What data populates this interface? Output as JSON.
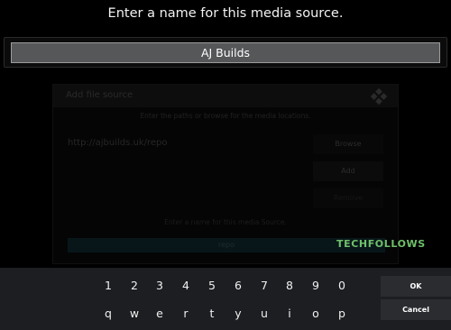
{
  "prompt": {
    "title": "Enter a name for this media source."
  },
  "name_input": {
    "value": "AJ Builds"
  },
  "background_dialog": {
    "title": "Add file source",
    "instructions": "Enter the paths or browse for the media locations.",
    "path": "http://ajbuilds.uk/repo",
    "browse_label": "Browse",
    "add_label": "Add",
    "remove_label": "Remove",
    "name_prompt": "Enter a name for this media Source.",
    "name_value": "repo"
  },
  "watermark": {
    "text": "TECHFOLLOWS"
  },
  "keyboard": {
    "row1": [
      "1",
      "2",
      "3",
      "4",
      "5",
      "6",
      "7",
      "8",
      "9",
      "0"
    ],
    "row2": [
      "q",
      "w",
      "e",
      "r",
      "t",
      "y",
      "u",
      "i",
      "o",
      "p"
    ],
    "ok_label": "OK",
    "cancel_label": "Cancel"
  },
  "colors": {
    "background": "#000000",
    "input_fill": "#555759",
    "keyboard_bg": "#1c1e21",
    "watermark": "#6fc06a"
  }
}
